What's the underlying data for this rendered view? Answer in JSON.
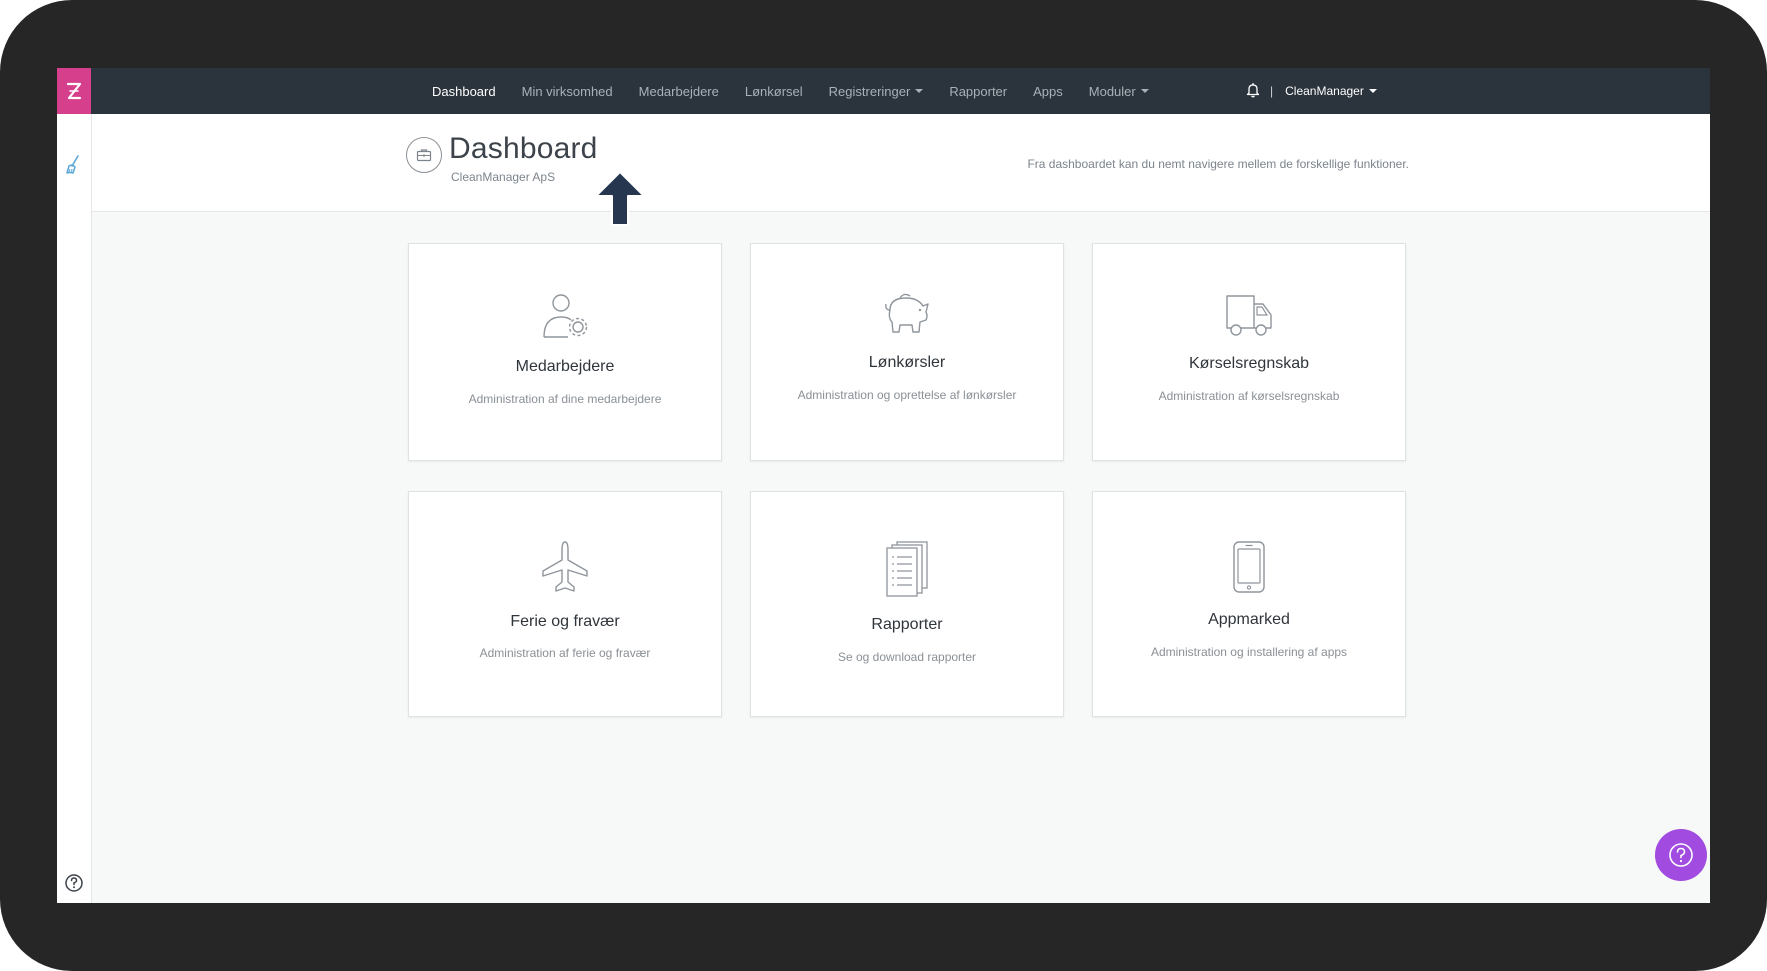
{
  "nav": {
    "items": [
      {
        "label": "Dashboard",
        "active": true,
        "dropdown": false
      },
      {
        "label": "Min virksomhed",
        "active": false,
        "dropdown": false
      },
      {
        "label": "Medarbejdere",
        "active": false,
        "dropdown": false
      },
      {
        "label": "Lønkørsel",
        "active": false,
        "dropdown": false
      },
      {
        "label": "Registreringer",
        "active": false,
        "dropdown": true
      },
      {
        "label": "Rapporter",
        "active": false,
        "dropdown": false
      },
      {
        "label": "Apps",
        "active": false,
        "dropdown": false
      },
      {
        "label": "Moduler",
        "active": false,
        "dropdown": true
      }
    ],
    "separator": "|",
    "user": "CleanManager",
    "bell_icon": "bell-icon"
  },
  "header": {
    "title": "Dashboard",
    "subtitle": "CleanManager ApS",
    "description": "Fra dashboardet kan du nemt navigere mellem de forskellige funktioner.",
    "icon": "briefcase-icon"
  },
  "cards": [
    {
      "title": "Medarbejdere",
      "desc": "Administration af dine medarbejdere",
      "icon": "user-gear-icon"
    },
    {
      "title": "Lønkørsler",
      "desc": "Administration og oprettelse af lønkørsler",
      "icon": "piggy-bank-icon"
    },
    {
      "title": "Kørselsregnskab",
      "desc": "Administration af kørselsregnskab",
      "icon": "truck-icon"
    },
    {
      "title": "Ferie og fravær",
      "desc": "Administration af ferie og fravær",
      "icon": "airplane-icon"
    },
    {
      "title": "Rapporter",
      "desc": "Se og download rapporter",
      "icon": "document-icon"
    },
    {
      "title": "Appmarked",
      "desc": "Administration og installering af apps",
      "icon": "smartphone-icon"
    }
  ],
  "colors": {
    "nav_bg": "#2b333c",
    "brand_pink": "#d63f8c",
    "help_purple": "#a14be0",
    "arrow": "#26364f"
  }
}
